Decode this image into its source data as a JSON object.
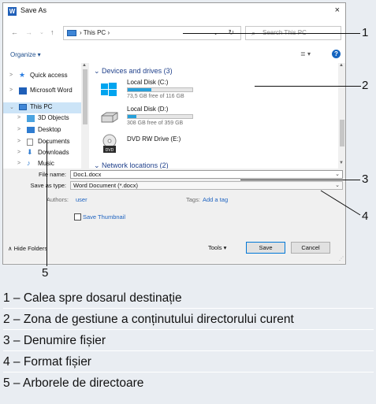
{
  "window": {
    "title": "Save As",
    "app_icon": "word-app-icon",
    "close_label": "×"
  },
  "nav": {
    "back": "←",
    "forward": "→",
    "up": "↑",
    "address": "This PC",
    "address_chevron": "›",
    "dropdown": "⌄",
    "refresh": "↻",
    "search_placeholder": "Search This PC",
    "search_icon": "⌕"
  },
  "commands": {
    "organize": "Organize ▾",
    "views": "≣ ▾",
    "help": "?"
  },
  "tree": {
    "items": [
      {
        "label": "Quick access",
        "icon": "star-icon",
        "expander": ">"
      },
      {
        "label": "Microsoft Word",
        "icon": "word-icon",
        "expander": ">"
      },
      {
        "label": "This PC",
        "icon": "pc-icon",
        "expander": "⌄"
      },
      {
        "label": "3D Objects",
        "icon": "cube-icon",
        "expander": ">"
      },
      {
        "label": "Desktop",
        "icon": "desktop-icon",
        "expander": ">"
      },
      {
        "label": "Documents",
        "icon": "document-icon",
        "expander": ">"
      },
      {
        "label": "Downloads",
        "icon": "download-icon",
        "expander": ">"
      },
      {
        "label": "Music",
        "icon": "music-icon",
        "expander": ">"
      }
    ]
  },
  "content": {
    "group_devices": "Devices and drives (3)",
    "group_network": "Network locations (2)",
    "drives": [
      {
        "name": "Local Disk (C:)",
        "free": "73,5 GB free of 116 GB",
        "used_fraction": 0.37
      },
      {
        "name": "Local Disk (D:)",
        "free": "308 GB free of 359 GB",
        "used_fraction": 0.14
      },
      {
        "name": "DVD RW Drive (E:)",
        "free": "",
        "used_fraction": 0
      }
    ]
  },
  "form": {
    "file_name_label": "File name:",
    "file_name_value": "Doc1.docx",
    "save_type_label": "Save as type:",
    "save_type_value": "Word Document (*.docx)",
    "authors_label": "Authors:",
    "authors_value": "user",
    "tags_label": "Tags:",
    "tags_value": "Add a tag",
    "thumbnail_label": "Save Thumbnail",
    "hide_folders": "Hide Folders",
    "tools": "Tools",
    "save": "Save",
    "cancel": "Cancel"
  },
  "callouts": [
    "1",
    "2",
    "3",
    "4",
    "5"
  ],
  "legend": [
    "1 – Calea spre dosarul destinație",
    "2 – Zona de gestiune a conținutului directorului curent",
    "3 – Denumire fișier",
    "4 – Format fișier",
    "5 – Arborele de directoare"
  ],
  "colors": {
    "accent": "#0078d7",
    "drive_fill": "#26a0da",
    "link": "#1e63c0",
    "legend_bg": "#e9edf2"
  }
}
